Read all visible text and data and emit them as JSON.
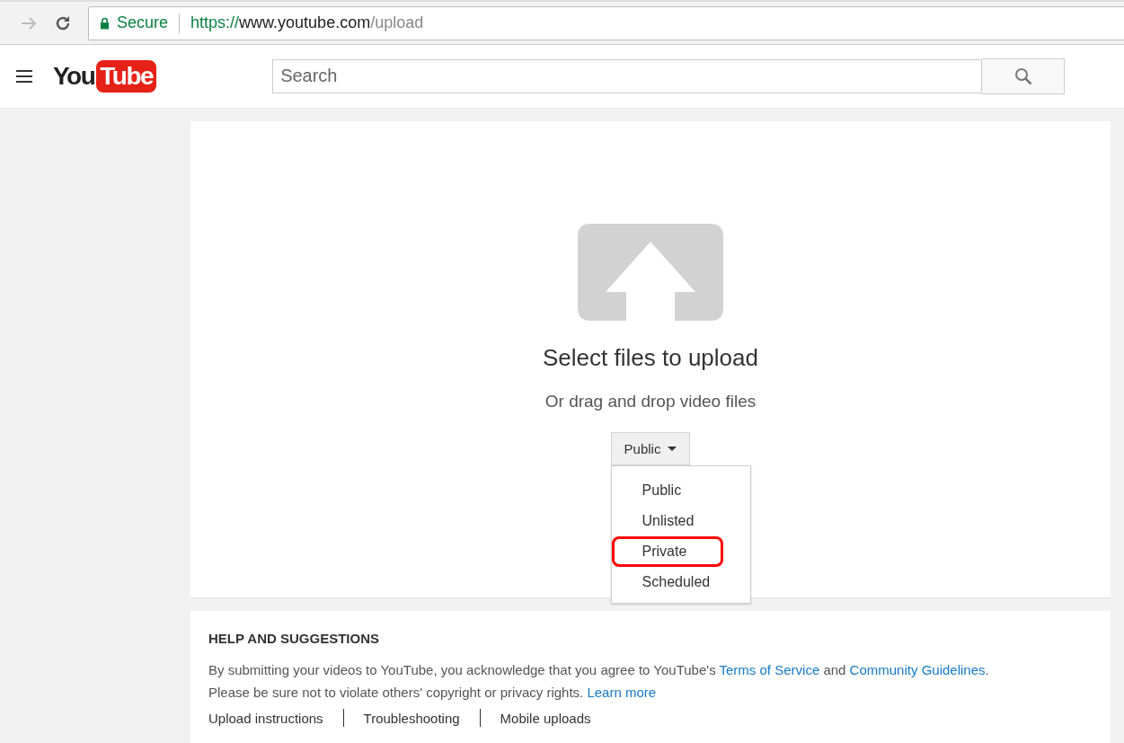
{
  "browser": {
    "security": "Secure",
    "url": {
      "scheme": "https://",
      "host": "www.youtube.com",
      "path": "/upload"
    }
  },
  "header": {
    "logo": {
      "left": "You",
      "right": "Tube"
    },
    "search": {
      "placeholder": "Search"
    }
  },
  "upload": {
    "title": "Select files to upload",
    "subtitle": "Or drag and drop video files",
    "privacy": {
      "value": "Public",
      "expanded": true,
      "options": [
        {
          "label": "Public",
          "highlighted": false
        },
        {
          "label": "Unlisted",
          "highlighted": false
        },
        {
          "label": "Private",
          "highlighted": true
        },
        {
          "label": "Scheduled",
          "highlighted": false
        }
      ]
    }
  },
  "help": {
    "heading": "HELP AND SUGGESTIONS",
    "lines": [
      [
        {
          "text": "By submitting your videos to YouTube, you acknowledge that you agree to YouTube's ",
          "link": false
        },
        {
          "text": "Terms of Service",
          "link": true
        },
        {
          "text": " and ",
          "link": false
        },
        {
          "text": "Community Guidelines",
          "link": true
        },
        {
          "text": ".",
          "link": false
        }
      ],
      [
        {
          "text": "Please be sure not to violate others' copyright or privacy rights. ",
          "link": false
        },
        {
          "text": "Learn more",
          "link": true
        }
      ]
    ],
    "links": [
      "Upload instructions",
      "Troubleshooting",
      "Mobile uploads"
    ]
  }
}
